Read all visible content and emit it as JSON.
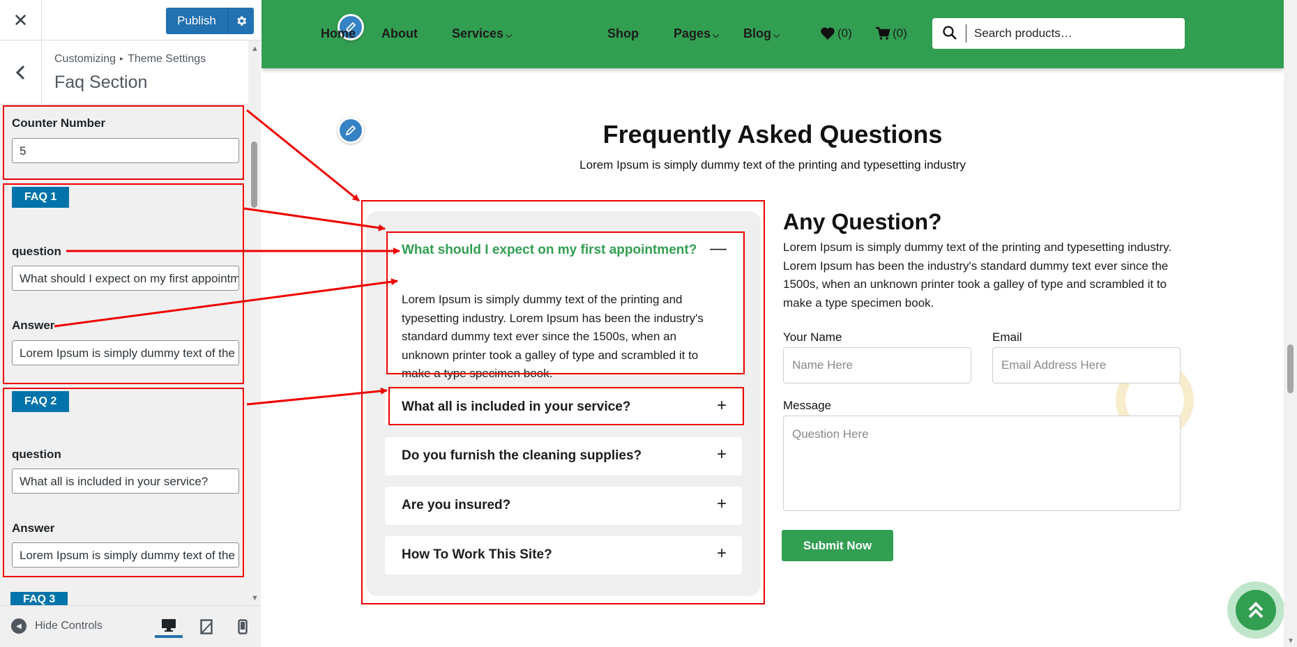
{
  "customizer": {
    "close_icon": "close-icon",
    "publish_label": "Publish",
    "settings_icon": "gear-icon",
    "breadcrumb": [
      "Customizing",
      "Theme Settings"
    ],
    "section_title": "Faq Section",
    "counter": {
      "label": "Counter Number",
      "value": "5"
    },
    "faqs": [
      {
        "tag": "FAQ 1",
        "question_label": "question",
        "question_value": "What should I expect on my first appointment?",
        "answer_label": "Answer",
        "answer_value": "Lorem Ipsum is simply dummy text of the printing and typesetting industry."
      },
      {
        "tag": "FAQ 2",
        "question_label": "question",
        "question_value": "What all is included in your service?",
        "answer_label": "Answer",
        "answer_value": "Lorem Ipsum is simply dummy text of the printing and typesetting industry."
      },
      {
        "tag": "FAQ 3"
      }
    ],
    "hide_controls": "Hide Controls"
  },
  "nav": {
    "links": [
      "Home",
      "About",
      "Services",
      "Shop",
      "Pages",
      "Blog"
    ],
    "wishlist_count": "(0)",
    "cart_count": "(0)",
    "search_placeholder": "Search products…"
  },
  "faq": {
    "heading": "Frequently Asked Questions",
    "subheading": "Lorem Ipsum is simply dummy text of the printing and typesetting industry",
    "items": [
      {
        "question": "What should I expect on my first appointment?",
        "toggle": "—",
        "answer": "Lorem Ipsum is simply dummy text of the printing and typesetting industry. Lorem Ipsum has been the industry's standard dummy text ever since the 1500s, when an unknown printer took a galley of type and scrambled it to make a type specimen book."
      },
      {
        "question": "What all is included in your service?",
        "toggle": "+"
      },
      {
        "question": "Do you furnish the cleaning supplies?",
        "toggle": "+"
      },
      {
        "question": "Are you insured?",
        "toggle": "+"
      },
      {
        "question": "How To Work This Site?",
        "toggle": "+"
      }
    ]
  },
  "contact": {
    "title": "Any Question?",
    "text": "Lorem Ipsum is simply dummy text of the printing and typesetting industry. Lorem Ipsum has been the industry's standard dummy text ever since the 1500s, when an unknown printer took a galley of type and scrambled it to make a type specimen book.",
    "name_label": "Your Name",
    "name_placeholder": "Name Here",
    "email_label": "Email",
    "email_placeholder": "Email Address Here",
    "message_label": "Message",
    "message_placeholder": "Question Here",
    "submit_label": "Submit Now"
  },
  "colors": {
    "brand_green": "#329e52",
    "wp_blue": "#2271b1",
    "annotation_red": "#ee0000"
  }
}
